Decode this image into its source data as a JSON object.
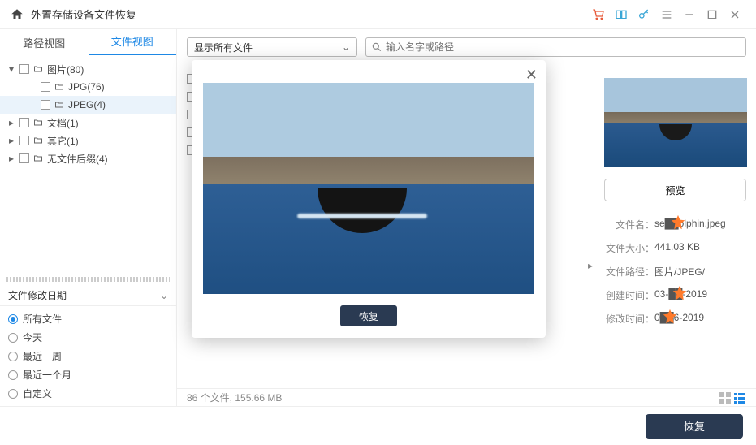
{
  "titlebar": {
    "title": "外置存储设备文件恢复"
  },
  "tabs": {
    "path": "路径视图",
    "file": "文件视图"
  },
  "tree": [
    {
      "label": "图片(80)",
      "level": 1,
      "arrow": "▾",
      "selected": false
    },
    {
      "label": "JPG(76)",
      "level": 2,
      "arrow": "",
      "selected": false
    },
    {
      "label": "JPEG(4)",
      "level": 2,
      "arrow": "",
      "selected": true
    },
    {
      "label": "文档(1)",
      "level": 1,
      "arrow": "▸",
      "selected": false
    },
    {
      "label": "其它(1)",
      "level": 1,
      "arrow": "▸",
      "selected": false
    },
    {
      "label": "无文件后缀(4)",
      "level": 1,
      "arrow": "▸",
      "selected": false
    }
  ],
  "filter": {
    "heading": "文件修改日期",
    "options": [
      "所有文件",
      "今天",
      "最近一周",
      "最近一个月",
      "自定义"
    ],
    "active": 0
  },
  "toolbar": {
    "select_label": "显示所有文件",
    "search_placeholder": "输入名字或路径"
  },
  "details": {
    "preview_btn": "预览",
    "rows": [
      {
        "label": "文件名",
        "value": "se██olphin.jpeg",
        "starLeft": 18
      },
      {
        "label": "文件大小",
        "value": "441.03  KB"
      },
      {
        "label": "文件路径",
        "value": "图片/JPEG/"
      },
      {
        "label": "创建时间",
        "value": "03-██-2019",
        "starLeft": 20
      },
      {
        "label": "修改时间",
        "value": "0██6-2019",
        "starLeft": 8
      }
    ]
  },
  "status": {
    "text": "86 个文件, 155.66  MB"
  },
  "buttons": {
    "recover": "恢复",
    "modal_recover": "恢复"
  }
}
